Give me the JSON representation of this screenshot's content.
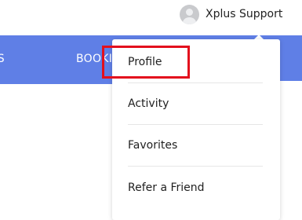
{
  "user": {
    "name": "Xplus Support",
    "avatar_icon": "user-avatar-icon"
  },
  "nav": {
    "left_fragment": "NS",
    "middle_fragment": "BOOKIN"
  },
  "menu": {
    "items": [
      {
        "label": "Profile"
      },
      {
        "label": "Activity"
      },
      {
        "label": "Favorites"
      },
      {
        "label": "Refer a Friend"
      }
    ]
  },
  "colors": {
    "nav_bg": "#5f7fe6",
    "highlight": "#e3101d"
  }
}
